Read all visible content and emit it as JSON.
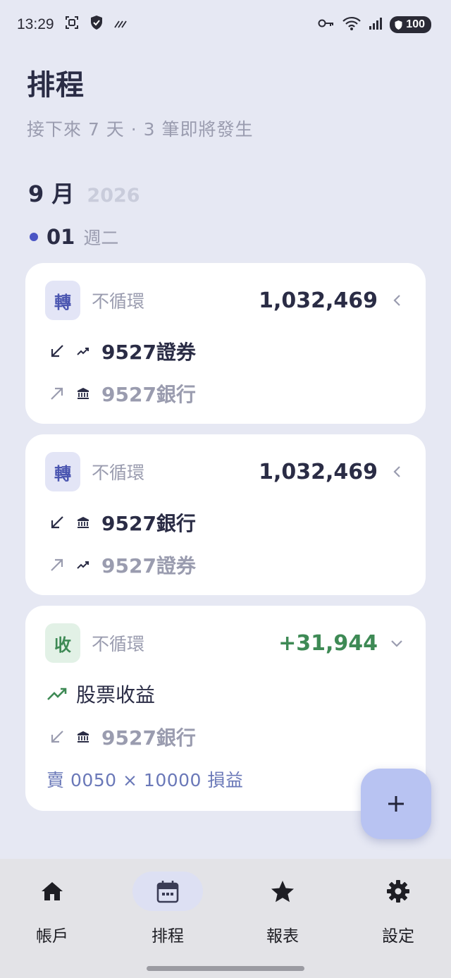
{
  "status_bar": {
    "time": "13:29",
    "battery": "100"
  },
  "header": {
    "title": "排程",
    "subtitle": "接下來 7 天 · 3 筆即將發生"
  },
  "month": {
    "label": "9 月",
    "year": "2026"
  },
  "day": {
    "date": "01",
    "weekday": "週二"
  },
  "cards": [
    {
      "type_badge": "轉",
      "cycle": "不循環",
      "amount": "1,032,469",
      "from_name": "9527證券",
      "from_icon": "trending-up-icon",
      "to_name": "9527銀行",
      "to_icon": "bank-icon"
    },
    {
      "type_badge": "轉",
      "cycle": "不循環",
      "amount": "1,032,469",
      "from_name": "9527銀行",
      "from_icon": "bank-icon",
      "to_name": "9527證券",
      "to_icon": "trending-up-icon"
    },
    {
      "type_badge": "收",
      "cycle": "不循環",
      "amount": "+31,944",
      "category": "股票收益",
      "category_icon": "trending-up-icon",
      "to_name": "9527銀行",
      "to_icon": "bank-icon",
      "note": "賣 0050 × 10000 損益"
    }
  ],
  "fab": {
    "icon": "plus-icon"
  },
  "bottom_nav": [
    {
      "label": "帳戶",
      "icon": "home-icon"
    },
    {
      "label": "排程",
      "icon": "calendar-icon"
    },
    {
      "label": "報表",
      "icon": "star-icon"
    },
    {
      "label": "設定",
      "icon": "gear-icon"
    }
  ],
  "colors": {
    "background": "#e6e8f3",
    "accent": "#4a55c4",
    "income": "#3e8a55",
    "fab": "#b8c3f2",
    "nav_active": "#dde0f3"
  }
}
